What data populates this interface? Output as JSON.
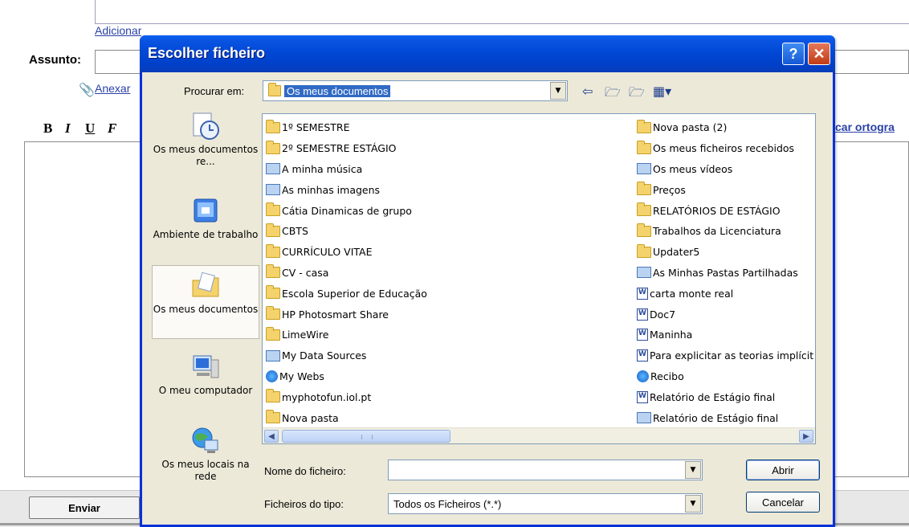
{
  "background": {
    "add_links": "Adicionar Cc | Adicionar Bcc",
    "subject_label": "Assunto:",
    "attach_link": "Anexar",
    "format_buttons": [
      "B",
      "I",
      "U",
      "F"
    ],
    "spellcheck_link": "car ortogra",
    "send_button": "Enviar"
  },
  "dialog": {
    "title": "Escolher ficheiro",
    "help_button": "?",
    "close_button": "✕",
    "look_in_label": "Procurar em:",
    "look_in_value": "Os meus documentos",
    "places": [
      {
        "label": "Os meus documentos re...",
        "icon": "recent-documents-icon"
      },
      {
        "label": "Ambiente de trabalho",
        "icon": "desktop-icon"
      },
      {
        "label": "Os meus documentos",
        "icon": "my-documents-icon"
      },
      {
        "label": "O meu computador",
        "icon": "my-computer-icon"
      },
      {
        "label": "Os meus locais na rede",
        "icon": "network-places-icon"
      }
    ],
    "files_col1": [
      {
        "name": "1º SEMESTRE",
        "icon": "folder"
      },
      {
        "name": "2º SEMESTRE ESTÁGIO",
        "icon": "folder"
      },
      {
        "name": "A minha música",
        "icon": "music-folder"
      },
      {
        "name": "As minhas imagens",
        "icon": "pictures-folder"
      },
      {
        "name": "Cátia Dinamicas de grupo",
        "icon": "folder"
      },
      {
        "name": "CBTS",
        "icon": "folder"
      },
      {
        "name": "CURRÍCULO VITAE",
        "icon": "folder"
      },
      {
        "name": "CV - casa",
        "icon": "folder"
      },
      {
        "name": "Escola Superior de Educação",
        "icon": "folder"
      },
      {
        "name": "HP Photosmart Share",
        "icon": "folder"
      },
      {
        "name": "LimeWire",
        "icon": "folder"
      },
      {
        "name": "My Data Sources",
        "icon": "data-sources-folder"
      },
      {
        "name": "My Webs",
        "icon": "webs-folder"
      },
      {
        "name": "myphotofun.iol.pt",
        "icon": "folder"
      },
      {
        "name": "Nova pasta",
        "icon": "folder"
      }
    ],
    "files_col2": [
      {
        "name": "Nova pasta (2)",
        "icon": "folder"
      },
      {
        "name": "Os meus ficheiros recebidos",
        "icon": "folder"
      },
      {
        "name": "Os meus vídeos",
        "icon": "videos-folder"
      },
      {
        "name": "Preços",
        "icon": "folder"
      },
      {
        "name": "RELATÓRIOS DE ESTÁGIO",
        "icon": "folder"
      },
      {
        "name": "Trabalhos da Licenciatura",
        "icon": "folder"
      },
      {
        "name": "Updater5",
        "icon": "folder"
      },
      {
        "name": "As Minhas Pastas Partilhadas",
        "icon": "shared-folder"
      },
      {
        "name": "carta monte real",
        "icon": "word-document"
      },
      {
        "name": "Doc7",
        "icon": "word-document"
      },
      {
        "name": "Maninha",
        "icon": "word-document"
      },
      {
        "name": "Para explicitar as teorias implícitas",
        "icon": "word-document"
      },
      {
        "name": "Recibo",
        "icon": "internet-explorer-document"
      },
      {
        "name": "Relatório de Estágio final",
        "icon": "word-document"
      },
      {
        "name": "Relatório de Estágio final",
        "icon": "generic-document"
      }
    ],
    "filename_label": "Nome do ficheiro:",
    "filename_value": "",
    "filetype_label": "Ficheiros do tipo:",
    "filetype_value": "Todos os Ficheiros (*.*)",
    "open_button": "Abrir",
    "cancel_button": "Cancelar"
  },
  "colors": {
    "titlebar": "#0048d8",
    "dialog_bg": "#ece9d8",
    "selection": "#316ac5",
    "link": "#2a41a8"
  }
}
